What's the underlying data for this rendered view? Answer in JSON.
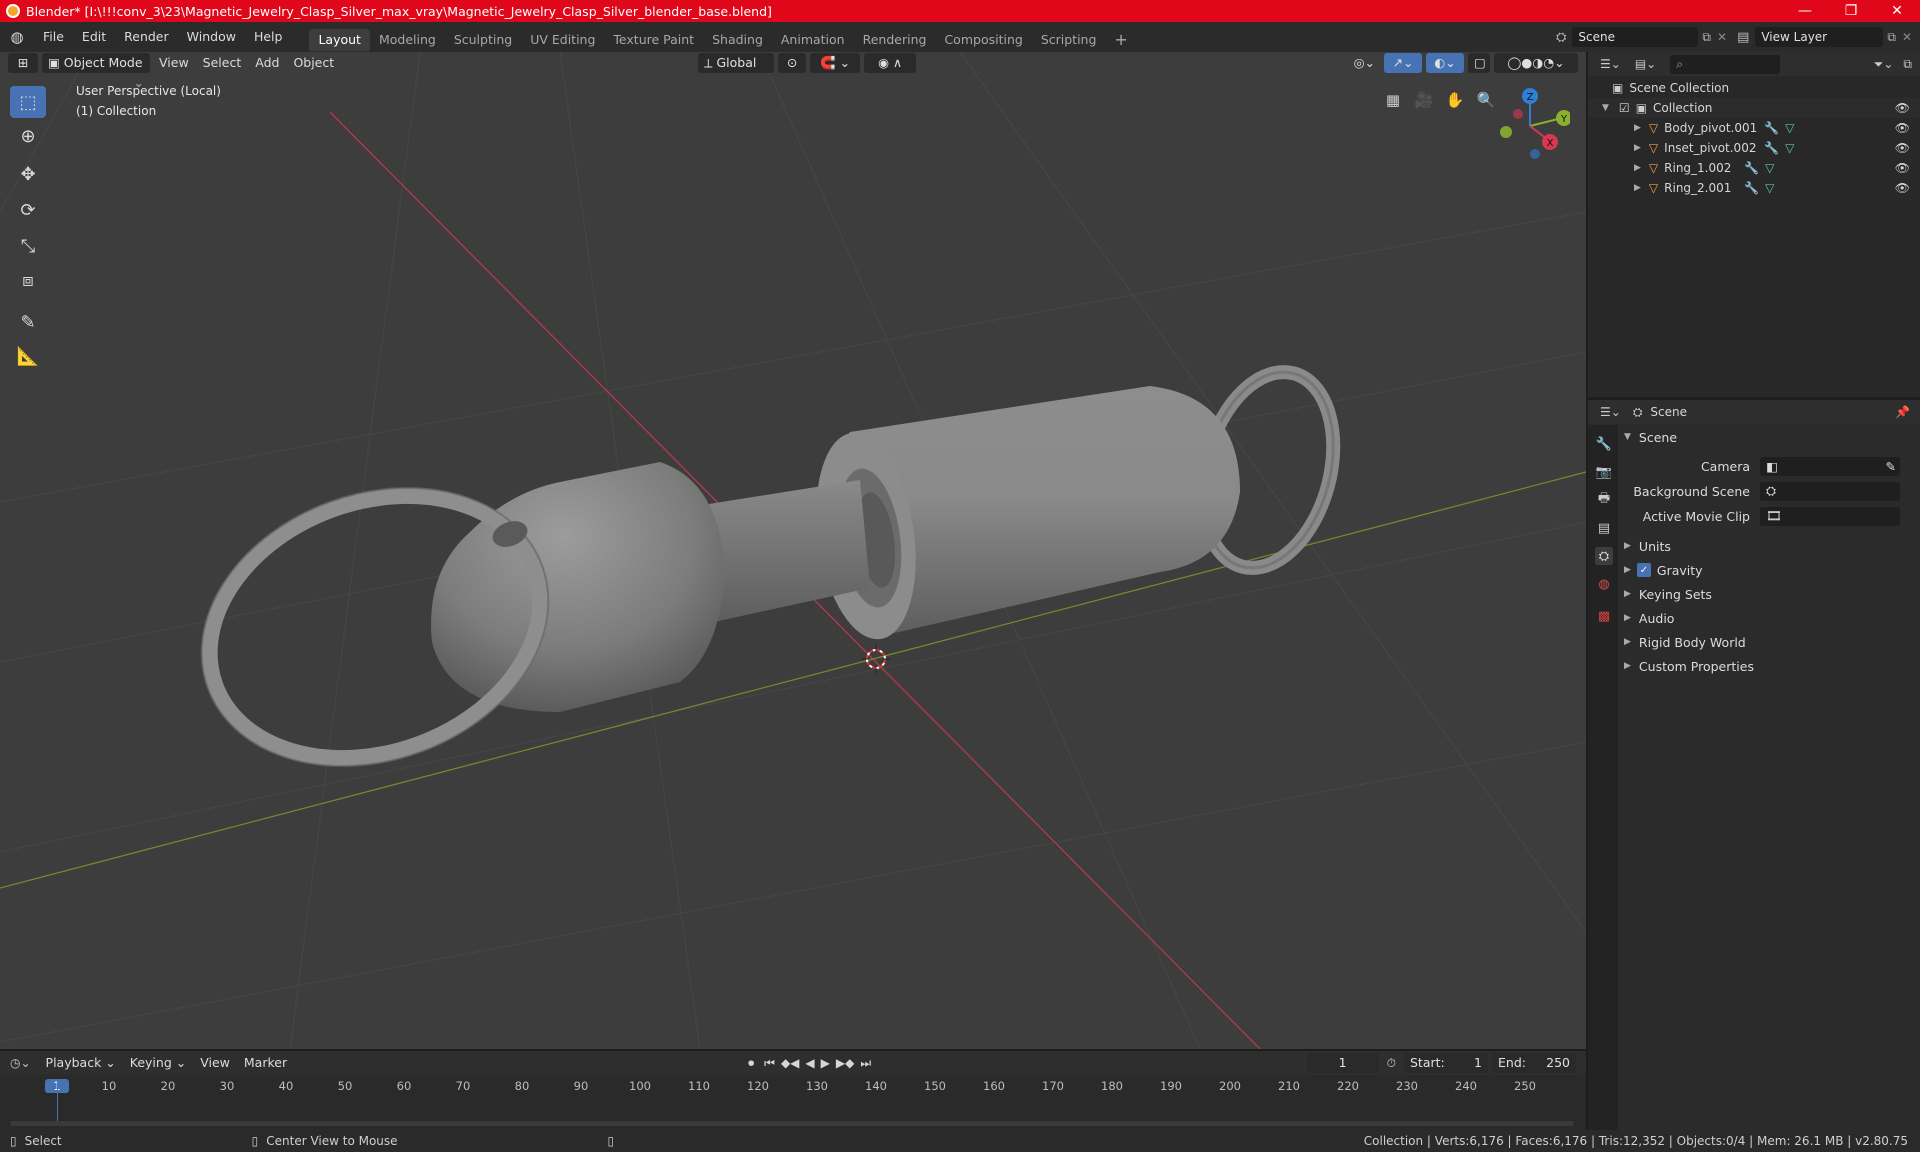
{
  "window": {
    "title": "Blender* [I:\\!!!conv_3\\23\\Magnetic_Jewelry_Clasp_Silver_max_vray\\Magnetic_Jewelry_Clasp_Silver_blender_base.blend]",
    "minimize": "—",
    "maximize": "❐",
    "close": "✕"
  },
  "menubar": {
    "menus": [
      "File",
      "Edit",
      "Render",
      "Window",
      "Help"
    ],
    "workspaces": [
      "Layout",
      "Modeling",
      "Sculpting",
      "UV Editing",
      "Texture Paint",
      "Shading",
      "Animation",
      "Rendering",
      "Compositing",
      "Scripting"
    ],
    "active_workspace": "Layout",
    "add_tab": "+",
    "scene": "Scene",
    "view_layer": "View Layer"
  },
  "viewport_header": {
    "mode": "Object Mode",
    "menus": [
      "View",
      "Select",
      "Add",
      "Object"
    ],
    "orientation": "Global"
  },
  "viewport": {
    "overlay_line1": "User Perspective (Local)",
    "overlay_line2": "(1) Collection",
    "gizmo": {
      "x": "X",
      "y": "Y",
      "z": "Z"
    }
  },
  "tools": [
    "select-box",
    "cursor",
    "move",
    "rotate",
    "scale",
    "transform",
    "annotate",
    "measure"
  ],
  "outliner": {
    "root": "Scene Collection",
    "collection": "Collection",
    "objects": [
      "Body_pivot.001",
      "Inset_pivot.002",
      "Ring_1.002",
      "Ring_2.001"
    ]
  },
  "properties": {
    "header": "Scene",
    "panel_title": "Scene",
    "fields": [
      {
        "label": "Camera",
        "value": ""
      },
      {
        "label": "Background Scene",
        "value": ""
      },
      {
        "label": "Active Movie Clip",
        "value": ""
      }
    ],
    "subpanels": [
      "Units",
      "Gravity",
      "Keying Sets",
      "Audio",
      "Rigid Body World",
      "Custom Properties"
    ],
    "gravity_checked": true
  },
  "timeline": {
    "menus": [
      "Playback",
      "Keying",
      "View",
      "Marker"
    ],
    "current_frame": "1",
    "start_label": "Start:",
    "start": "1",
    "end_label": "End:",
    "end": "250",
    "ticks": [
      "1",
      "10",
      "20",
      "30",
      "40",
      "50",
      "60",
      "70",
      "80",
      "90",
      "100",
      "110",
      "120",
      "130",
      "140",
      "150",
      "160",
      "170",
      "180",
      "190",
      "200",
      "210",
      "220",
      "230",
      "240",
      "250"
    ]
  },
  "statusbar": {
    "select": "Select",
    "center": "Center View to Mouse",
    "stats": "Collection | Verts:6,176 | Faces:6,176 | Tris:12,352 | Objects:0/4 | Mem: 26.1 MB | v2.80.75"
  },
  "colors": {
    "titlebar": "#e0071b",
    "accent": "#4772b3",
    "x_axis": "#d6394f",
    "y_axis": "#8ab02e",
    "z_axis": "#2f7fd6"
  }
}
